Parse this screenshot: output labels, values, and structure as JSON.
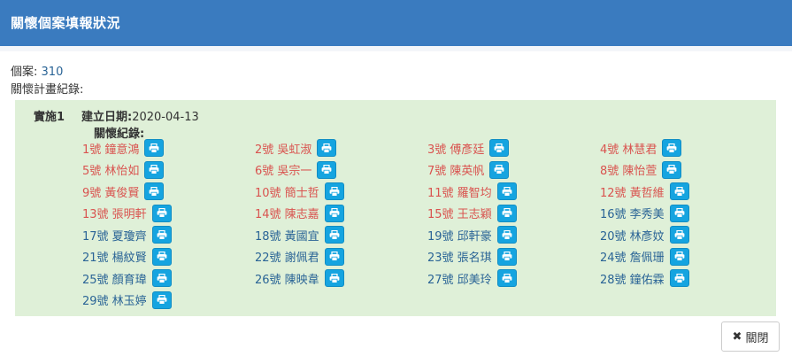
{
  "header": {
    "title": "關懷個案填報狀況"
  },
  "case": {
    "label": "個案:",
    "number": "310"
  },
  "plan_label": "關懷計畫紀錄:",
  "implementation": {
    "label": "實施1",
    "date_label": "建立日期:",
    "date_value": "2020-04-13",
    "records_label": "關懷紀錄:"
  },
  "records": [
    {
      "text": "1號 鐘意鴻",
      "status": "red"
    },
    {
      "text": "2號 吳虹淑",
      "status": "red"
    },
    {
      "text": "3號 傅彥廷",
      "status": "red"
    },
    {
      "text": "4號 林慧君",
      "status": "red"
    },
    {
      "text": "5號 林怡如",
      "status": "red"
    },
    {
      "text": "6號 吳宗一",
      "status": "red"
    },
    {
      "text": "7號 陳英帆",
      "status": "red"
    },
    {
      "text": "8號 陳怡萱",
      "status": "red"
    },
    {
      "text": "9號 黃俊賢",
      "status": "red"
    },
    {
      "text": "10號 簡士哲",
      "status": "red"
    },
    {
      "text": "11號 羅智均",
      "status": "red"
    },
    {
      "text": "12號 黃哲維",
      "status": "red"
    },
    {
      "text": "13號 張明軒",
      "status": "red"
    },
    {
      "text": "14號 陳志嘉",
      "status": "red"
    },
    {
      "text": "15號 王志穎",
      "status": "red"
    },
    {
      "text": "16號 李秀美",
      "status": "blue"
    },
    {
      "text": "17號 夏瓊齊",
      "status": "blue"
    },
    {
      "text": "18號 黃國宜",
      "status": "blue"
    },
    {
      "text": "19號 邱軒豪",
      "status": "blue"
    },
    {
      "text": "20號 林彥妏",
      "status": "blue"
    },
    {
      "text": "21號 楊紋賢",
      "status": "blue"
    },
    {
      "text": "22號 謝佩君",
      "status": "blue"
    },
    {
      "text": "23號 張名琪",
      "status": "blue"
    },
    {
      "text": "24號 詹佩珊",
      "status": "blue"
    },
    {
      "text": "25號 顏育瑋",
      "status": "blue"
    },
    {
      "text": "26號 陳映韋",
      "status": "blue"
    },
    {
      "text": "27號 邱美玲",
      "status": "blue"
    },
    {
      "text": "28號 鐘佑霖",
      "status": "blue"
    },
    {
      "text": "29號 林玉婷",
      "status": "blue"
    }
  ],
  "icons": {
    "print": "print-icon",
    "close": "close-icon"
  },
  "colors": {
    "header_bg": "#3a7bbf",
    "panel_bg": "#dff0d8",
    "record_red": "#d9534f",
    "record_blue": "#2a6496",
    "print_button": "#15a4e0"
  },
  "footer": {
    "close_label": "關閉",
    "close_glyph": "✖"
  }
}
